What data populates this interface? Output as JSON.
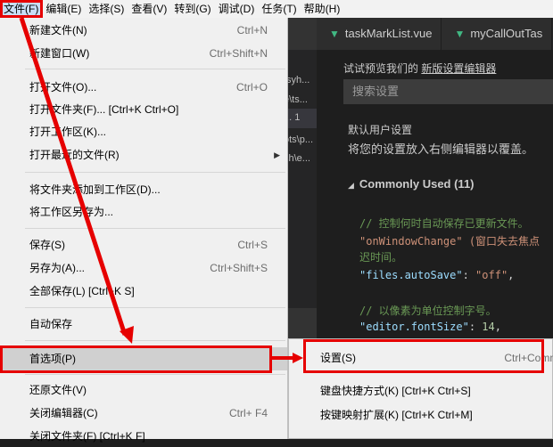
{
  "menubar": {
    "items": [
      {
        "label": "文件(F)"
      },
      {
        "label": "编辑(E)"
      },
      {
        "label": "选择(S)"
      },
      {
        "label": "查看(V)"
      },
      {
        "label": "转到(G)"
      },
      {
        "label": "调试(D)"
      },
      {
        "label": "任务(T)"
      },
      {
        "label": "帮助(H)"
      }
    ]
  },
  "tabs": [
    {
      "icon": "vue-icon",
      "label": "taskMarkList.vue"
    },
    {
      "icon": "vue-icon",
      "label": "myCallOutTas"
    }
  ],
  "explorer": {
    "rows": [
      "tsyh...",
      "e\\ts...",
      "... 1",
      "ots\\p...",
      "sh\\e..."
    ]
  },
  "settings": {
    "preview_prefix": "试试预览我们的",
    "preview_link": "新版设置编辑器",
    "search_placeholder": "搜索设置",
    "default_title": "默认用户设置",
    "default_desc": "将您的设置放入右侧编辑器以覆盖。",
    "section_header": "Commonly Used (11)",
    "code": {
      "comment1": "// 控制何时自动保存已更新文件。",
      "comment1_cont1": "\"onWindowChange\" (窗口失去焦点",
      "comment1_cont2": "迟时间。",
      "key1": "\"files.autoSave\"",
      "val1": "\"off\"",
      "comment2": "// 以像素为单位控制字号。",
      "key2": "\"editor.fontSize\"",
      "val2": "14"
    }
  },
  "file_menu": {
    "items": [
      {
        "label": "新建文件(N)",
        "shortcut": "Ctrl+N"
      },
      {
        "label": "新建窗口(W)",
        "shortcut": "Ctrl+Shift+N"
      },
      {
        "label": "打开文件(O)...",
        "shortcut": "Ctrl+O"
      },
      {
        "label": "打开文件夹(F)... [Ctrl+K Ctrl+O]",
        "shortcut": ""
      },
      {
        "label": "打开工作区(K)...",
        "shortcut": ""
      },
      {
        "label": "打开最近的文件(R)",
        "shortcut": ""
      },
      {
        "label": "将文件夹添加到工作区(D)...",
        "shortcut": ""
      },
      {
        "label": "将工作区另存为...",
        "shortcut": ""
      },
      {
        "label": "保存(S)",
        "shortcut": "Ctrl+S"
      },
      {
        "label": "另存为(A)...",
        "shortcut": "Ctrl+Shift+S"
      },
      {
        "label": "全部保存(L) [Ctrl+K S]",
        "shortcut": ""
      },
      {
        "label": "自动保存",
        "shortcut": ""
      },
      {
        "label": "首选项(P)",
        "shortcut": ""
      },
      {
        "label": "还原文件(V)",
        "shortcut": ""
      },
      {
        "label": "关闭编辑器(C)",
        "shortcut": "Ctrl+ F4"
      },
      {
        "label": "关闭文件夹(F) [Ctrl+K F]",
        "shortcut": ""
      }
    ]
  },
  "preferences_submenu": {
    "items": [
      {
        "label": "设置(S)",
        "shortcut": "Ctrl+Comma"
      },
      {
        "label": "键盘快捷方式(K) [Ctrl+K Ctrl+S]",
        "shortcut": ""
      },
      {
        "label": "按键映射扩展(K) [Ctrl+K Ctrl+M]",
        "shortcut": ""
      }
    ]
  },
  "colors": {
    "highlight_red": "#e60000",
    "menu_bg": "#f0f0f0",
    "editor_bg": "#1e1e1e"
  }
}
